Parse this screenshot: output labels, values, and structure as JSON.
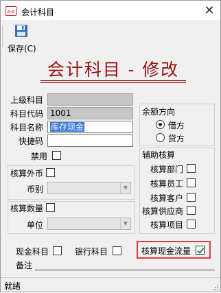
{
  "window": {
    "title": "会计科目",
    "close_glyph": "✕",
    "app_icon": "app-logo-icon"
  },
  "toolbar": {
    "save_label": "保存(C)",
    "save_icon": "floppy-disk-icon"
  },
  "form": {
    "heading": "会计科目 - 修改",
    "parent_account": {
      "label": "上级科目",
      "value": ""
    },
    "account_code": {
      "label": "科目代码",
      "value": "1001"
    },
    "account_name": {
      "label": "科目名称",
      "value": "库存现金"
    },
    "shortcut_code": {
      "label": "快捷码",
      "value": ""
    },
    "disabled": {
      "label": "禁用",
      "checked": false
    },
    "foreign_currency": {
      "label": "核算外币",
      "checked": false
    },
    "currency": {
      "label": "币别",
      "value": ""
    },
    "quantity": {
      "label": "核算数量",
      "checked": false
    },
    "unit": {
      "label": "单位",
      "value": ""
    },
    "balance_direction": {
      "title": "余额方向",
      "options": [
        {
          "label": "借方",
          "selected": true
        },
        {
          "label": "贷方",
          "selected": false
        }
      ]
    },
    "aux_accounting": {
      "title": "辅助核算",
      "items": [
        {
          "label": "核算部门",
          "checked": false
        },
        {
          "label": "核算员工",
          "checked": false
        },
        {
          "label": "核算客户",
          "checked": false
        },
        {
          "label": "核算供应商",
          "checked": false
        },
        {
          "label": "核算项目",
          "checked": false
        }
      ]
    },
    "cash_account": {
      "label": "现金科目",
      "checked": false
    },
    "bank_account": {
      "label": "银行科目",
      "checked": false
    },
    "cash_flow": {
      "label": "核算现金流量",
      "checked": true
    },
    "memo": {
      "label": "备注",
      "value": ""
    }
  },
  "status": {
    "text": "就绪"
  },
  "colors": {
    "heading": "#9b1010",
    "highlight_box": "#e03c3c",
    "check_green": "#1e8a2e",
    "selection": "#3979d4"
  }
}
